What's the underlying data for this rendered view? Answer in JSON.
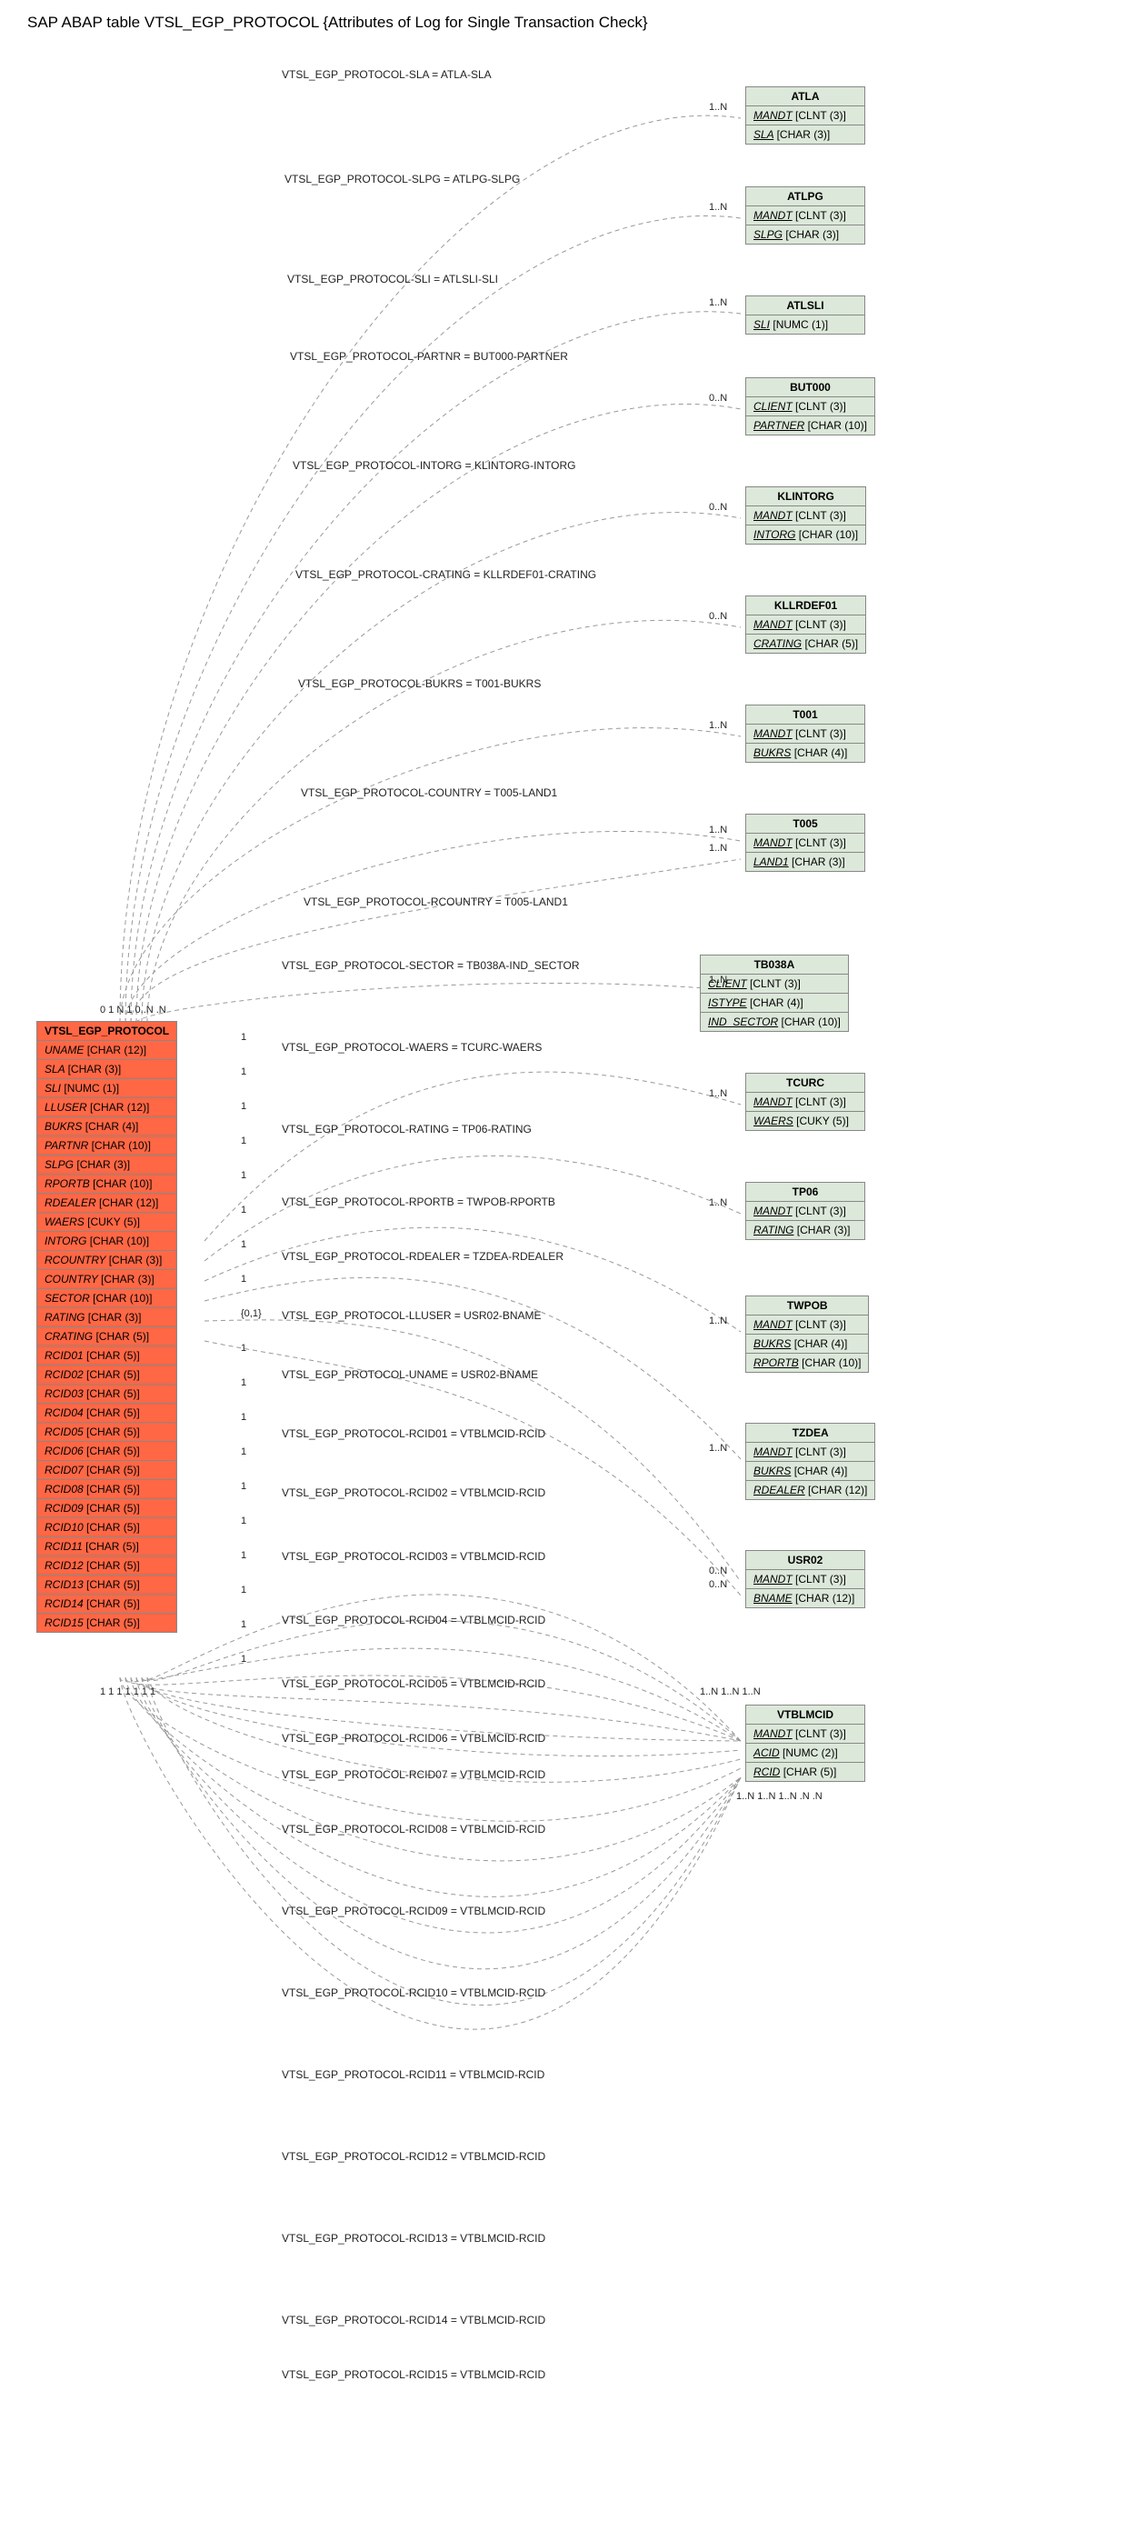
{
  "title": "SAP ABAP table VTSL_EGP_PROTOCOL {Attributes of Log for Single Transaction Check}",
  "main_entity": {
    "name": "VTSL_EGP_PROTOCOL",
    "fields": [
      {
        "name": "UNAME",
        "type": "[CHAR (12)]"
      },
      {
        "name": "SLA",
        "type": "[CHAR (3)]"
      },
      {
        "name": "SLI",
        "type": "[NUMC (1)]"
      },
      {
        "name": "LLUSER",
        "type": "[CHAR (12)]"
      },
      {
        "name": "BUKRS",
        "type": "[CHAR (4)]"
      },
      {
        "name": "PARTNR",
        "type": "[CHAR (10)]"
      },
      {
        "name": "SLPG",
        "type": "[CHAR (3)]"
      },
      {
        "name": "RPORTB",
        "type": "[CHAR (10)]"
      },
      {
        "name": "RDEALER",
        "type": "[CHAR (12)]"
      },
      {
        "name": "WAERS",
        "type": "[CUKY (5)]"
      },
      {
        "name": "INTORG",
        "type": "[CHAR (10)]"
      },
      {
        "name": "RCOUNTRY",
        "type": "[CHAR (3)]"
      },
      {
        "name": "COUNTRY",
        "type": "[CHAR (3)]"
      },
      {
        "name": "SECTOR",
        "type": "[CHAR (10)]"
      },
      {
        "name": "RATING",
        "type": "[CHAR (3)]"
      },
      {
        "name": "CRATING",
        "type": "[CHAR (5)]"
      },
      {
        "name": "RCID01",
        "type": "[CHAR (5)]"
      },
      {
        "name": "RCID02",
        "type": "[CHAR (5)]"
      },
      {
        "name": "RCID03",
        "type": "[CHAR (5)]"
      },
      {
        "name": "RCID04",
        "type": "[CHAR (5)]"
      },
      {
        "name": "RCID05",
        "type": "[CHAR (5)]"
      },
      {
        "name": "RCID06",
        "type": "[CHAR (5)]"
      },
      {
        "name": "RCID07",
        "type": "[CHAR (5)]"
      },
      {
        "name": "RCID08",
        "type": "[CHAR (5)]"
      },
      {
        "name": "RCID09",
        "type": "[CHAR (5)]"
      },
      {
        "name": "RCID10",
        "type": "[CHAR (5)]"
      },
      {
        "name": "RCID11",
        "type": "[CHAR (5)]"
      },
      {
        "name": "RCID12",
        "type": "[CHAR (5)]"
      },
      {
        "name": "RCID13",
        "type": "[CHAR (5)]"
      },
      {
        "name": "RCID14",
        "type": "[CHAR (5)]"
      },
      {
        "name": "RCID15",
        "type": "[CHAR (5)]"
      }
    ]
  },
  "entities": [
    {
      "name": "ATLA",
      "fields": [
        {
          "name": "MANDT",
          "type": "[CLNT (3)]",
          "pk": true
        },
        {
          "name": "SLA",
          "type": "[CHAR (3)]",
          "pk": true
        }
      ]
    },
    {
      "name": "ATLPG",
      "fields": [
        {
          "name": "MANDT",
          "type": "[CLNT (3)]",
          "pk": true
        },
        {
          "name": "SLPG",
          "type": "[CHAR (3)]",
          "pk": true
        }
      ]
    },
    {
      "name": "ATLSLI",
      "fields": [
        {
          "name": "SLI",
          "type": "[NUMC (1)]",
          "pk": true
        }
      ]
    },
    {
      "name": "BUT000",
      "fields": [
        {
          "name": "CLIENT",
          "type": "[CLNT (3)]",
          "pk": true
        },
        {
          "name": "PARTNER",
          "type": "[CHAR (10)]",
          "pk": true
        }
      ]
    },
    {
      "name": "KLINTORG",
      "fields": [
        {
          "name": "MANDT",
          "type": "[CLNT (3)]",
          "pk": true
        },
        {
          "name": "INTORG",
          "type": "[CHAR (10)]",
          "pk": true
        }
      ]
    },
    {
      "name": "KLLRDEF01",
      "fields": [
        {
          "name": "MANDT",
          "type": "[CLNT (3)]",
          "pk": true
        },
        {
          "name": "CRATING",
          "type": "[CHAR (5)]",
          "pk": true
        }
      ]
    },
    {
      "name": "T001",
      "fields": [
        {
          "name": "MANDT",
          "type": "[CLNT (3)]",
          "pk": true
        },
        {
          "name": "BUKRS",
          "type": "[CHAR (4)]",
          "pk": true
        }
      ]
    },
    {
      "name": "T005",
      "fields": [
        {
          "name": "MANDT",
          "type": "[CLNT (3)]",
          "pk": true
        },
        {
          "name": "LAND1",
          "type": "[CHAR (3)]",
          "pk": true
        }
      ]
    },
    {
      "name": "TB038A",
      "fields": [
        {
          "name": "CLIENT",
          "type": "[CLNT (3)]",
          "pk": true
        },
        {
          "name": "ISTYPE",
          "type": "[CHAR (4)]",
          "pk": true
        },
        {
          "name": "IND_SECTOR",
          "type": "[CHAR (10)]",
          "pk": true
        }
      ]
    },
    {
      "name": "TCURC",
      "fields": [
        {
          "name": "MANDT",
          "type": "[CLNT (3)]",
          "pk": true
        },
        {
          "name": "WAERS",
          "type": "[CUKY (5)]",
          "pk": true
        }
      ]
    },
    {
      "name": "TP06",
      "fields": [
        {
          "name": "MANDT",
          "type": "[CLNT (3)]",
          "pk": true
        },
        {
          "name": "RATING",
          "type": "[CHAR (3)]",
          "pk": true
        }
      ]
    },
    {
      "name": "TWPOB",
      "fields": [
        {
          "name": "MANDT",
          "type": "[CLNT (3)]",
          "pk": true
        },
        {
          "name": "BUKRS",
          "type": "[CHAR (4)]",
          "pk": true
        },
        {
          "name": "RPORTB",
          "type": "[CHAR (10)]",
          "pk": true
        }
      ]
    },
    {
      "name": "TZDEA",
      "fields": [
        {
          "name": "MANDT",
          "type": "[CLNT (3)]",
          "pk": true
        },
        {
          "name": "BUKRS",
          "type": "[CHAR (4)]",
          "pk": true
        },
        {
          "name": "RDEALER",
          "type": "[CHAR (12)]",
          "pk": true
        }
      ]
    },
    {
      "name": "USR02",
      "fields": [
        {
          "name": "MANDT",
          "type": "[CLNT (3)]",
          "pk": true
        },
        {
          "name": "BNAME",
          "type": "[CHAR (12)]",
          "pk": true
        }
      ]
    },
    {
      "name": "VTBLMCID",
      "fields": [
        {
          "name": "MANDT",
          "type": "[CLNT (3)]",
          "pk": true
        },
        {
          "name": "ACID",
          "type": "[NUMC (2)]",
          "pk": true
        },
        {
          "name": "RCID",
          "type": "[CHAR (5)]",
          "pk": true
        }
      ]
    }
  ],
  "relationships": [
    {
      "label": "VTSL_EGP_PROTOCOL-SLA = ATLA-SLA",
      "card": "1..N"
    },
    {
      "label": "VTSL_EGP_PROTOCOL-SLPG = ATLPG-SLPG",
      "card": "1..N"
    },
    {
      "label": "VTSL_EGP_PROTOCOL-SLI = ATLSLI-SLI",
      "card": "1..N"
    },
    {
      "label": "VTSL_EGP_PROTOCOL-PARTNR = BUT000-PARTNER",
      "card": "0..N"
    },
    {
      "label": "VTSL_EGP_PROTOCOL-INTORG = KLINTORG-INTORG",
      "card": "0..N"
    },
    {
      "label": "VTSL_EGP_PROTOCOL-CRATING = KLLRDEF01-CRATING",
      "card": "0..N"
    },
    {
      "label": "VTSL_EGP_PROTOCOL-BUKRS = T001-BUKRS",
      "card": "1..N"
    },
    {
      "label": "VTSL_EGP_PROTOCOL-COUNTRY = T005-LAND1",
      "card": "1..N"
    },
    {
      "label": "VTSL_EGP_PROTOCOL-RCOUNTRY = T005-LAND1",
      "card": "1..N"
    },
    {
      "label": "VTSL_EGP_PROTOCOL-SECTOR = TB038A-IND_SECTOR",
      "card": "1..N"
    },
    {
      "label": "VTSL_EGP_PROTOCOL-WAERS = TCURC-WAERS",
      "card": "1..N"
    },
    {
      "label": "VTSL_EGP_PROTOCOL-RATING = TP06-RATING",
      "card": "1..N"
    },
    {
      "label": "VTSL_EGP_PROTOCOL-RPORTB = TWPOB-RPORTB",
      "card": "1..N"
    },
    {
      "label": "VTSL_EGP_PROTOCOL-RDEALER = TZDEA-RDEALER",
      "card": "1..N"
    },
    {
      "label": "VTSL_EGP_PROTOCOL-LLUSER = USR02-BNAME",
      "card": "0..N"
    },
    {
      "label": "VTSL_EGP_PROTOCOL-UNAME = USR02-BNAME",
      "card": "0..N"
    },
    {
      "label": "VTSL_EGP_PROTOCOL-RCID01 = VTBLMCID-RCID",
      "card": "1..N"
    },
    {
      "label": "VTSL_EGP_PROTOCOL-RCID02 = VTBLMCID-RCID",
      "card": "1..N"
    },
    {
      "label": "VTSL_EGP_PROTOCOL-RCID03 = VTBLMCID-RCID",
      "card": "1..N"
    },
    {
      "label": "VTSL_EGP_PROTOCOL-RCID04 = VTBLMCID-RCID",
      "card": "1..N"
    },
    {
      "label": "VTSL_EGP_PROTOCOL-RCID05 = VTBLMCID-RCID",
      "card": "1..N"
    },
    {
      "label": "VTSL_EGP_PROTOCOL-RCID06 = VTBLMCID-RCID",
      "card": "1..N"
    },
    {
      "label": "VTSL_EGP_PROTOCOL-RCID07 = VTBLMCID-RCID",
      "card": "1..N"
    },
    {
      "label": "VTSL_EGP_PROTOCOL-RCID08 = VTBLMCID-RCID",
      "card": "1..N"
    },
    {
      "label": "VTSL_EGP_PROTOCOL-RCID09 = VTBLMCID-RCID",
      "card": "1..N"
    },
    {
      "label": "VTSL_EGP_PROTOCOL-RCID10 = VTBLMCID-RCID",
      "card": "1..N"
    },
    {
      "label": "VTSL_EGP_PROTOCOL-RCID11 = VTBLMCID-RCID",
      "card": "1..N"
    },
    {
      "label": "VTSL_EGP_PROTOCOL-RCID12 = VTBLMCID-RCID",
      "card": "1..N"
    },
    {
      "label": "VTSL_EGP_PROTOCOL-RCID13 = VTBLMCID-RCID",
      "card": "1..N"
    },
    {
      "label": "VTSL_EGP_PROTOCOL-RCID14 = VTBLMCID-RCID",
      "card": "1..N"
    },
    {
      "label": "VTSL_EGP_PROTOCOL-RCID15 = VTBLMCID-RCID",
      "card": "1..N"
    }
  ],
  "left_cards_top": "0 1 N 1 0..N .N",
  "left_cards_bottom": "1 1 1 1 1 1 1",
  "right_side_ones": [
    "1",
    "1",
    "1",
    "1",
    "1",
    "1",
    "1",
    "1",
    "{0,1}",
    "1",
    "1",
    "1",
    "1",
    "1",
    "1",
    "1",
    "1",
    "1",
    "1"
  ],
  "right_vtblmcid_bottom": "1..N 1..N 1..N .N .N",
  "right_vtblmcid_top": "1..N 1..N 1..N",
  "chart_data": {
    "type": "erd",
    "main_table": "VTSL_EGP_PROTOCOL",
    "description": "Attributes of Log for Single Transaction Check",
    "tables": [
      "VTSL_EGP_PROTOCOL",
      "ATLA",
      "ATLPG",
      "ATLSLI",
      "BUT000",
      "KLINTORG",
      "KLLRDEF01",
      "T001",
      "T005",
      "TB038A",
      "TCURC",
      "TP06",
      "TWPOB",
      "TZDEA",
      "USR02",
      "VTBLMCID"
    ],
    "relationship_count": 31
  }
}
